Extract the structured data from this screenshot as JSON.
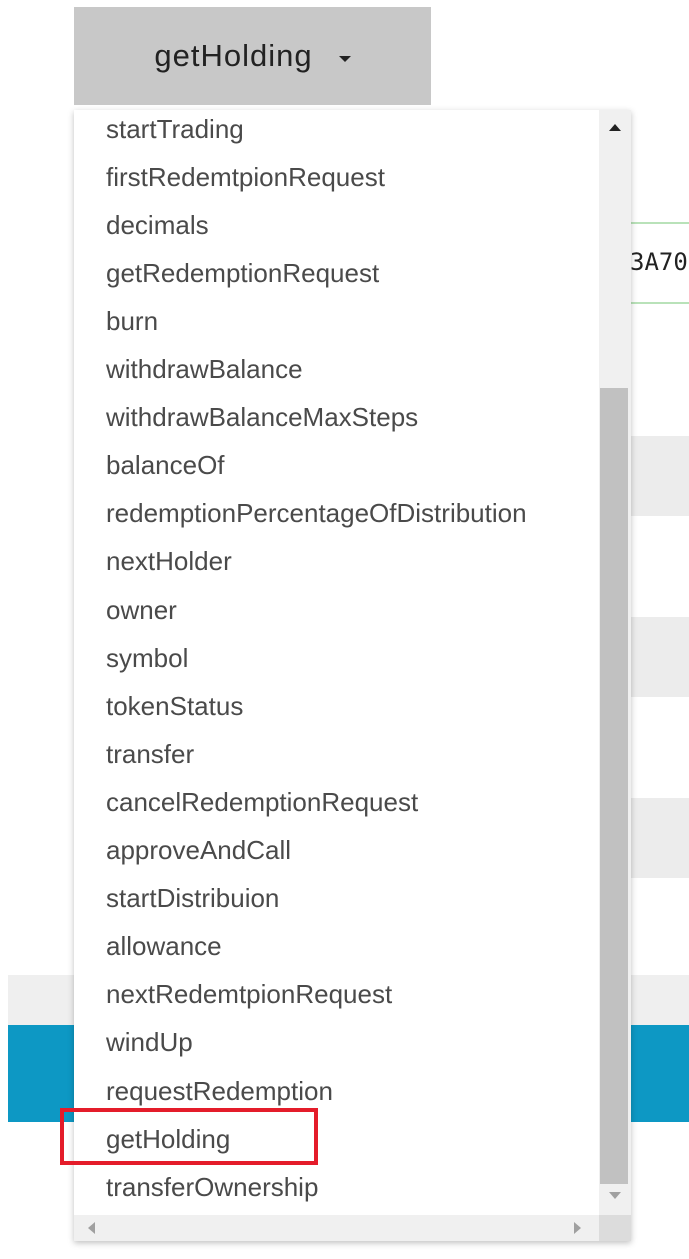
{
  "select": {
    "selected_label": "getHolding",
    "options": [
      "startTrading",
      "firstRedemtpionRequest",
      "decimals",
      "getRedemptionRequest",
      "burn",
      "withdrawBalance",
      "withdrawBalanceMaxSteps",
      "balanceOf",
      "redemptionPercentageOfDistribution",
      "nextHolder",
      "owner",
      "symbol",
      "tokenStatus",
      "transfer",
      "cancelRedemptionRequest",
      "approveAndCall",
      "startDistribuion",
      "allowance",
      "nextRedemtpionRequest",
      "windUp",
      "requestRedemption",
      "getHolding",
      "transferOwnership"
    ],
    "highlighted_option": "getHolding"
  },
  "background": {
    "address_fragment": "3A70"
  },
  "colors": {
    "select_button_bg": "#c8c8c8",
    "option_text": "#4a4a4a",
    "highlight_border": "#e41c2a",
    "blue_band": "#0d98c4"
  },
  "icons": {
    "caret": "chevron-down-icon",
    "scroll_up": "scroll-up-arrow-icon",
    "scroll_down": "scroll-down-arrow-icon",
    "scroll_left": "scroll-left-arrow-icon",
    "scroll_right": "scroll-right-arrow-icon"
  }
}
